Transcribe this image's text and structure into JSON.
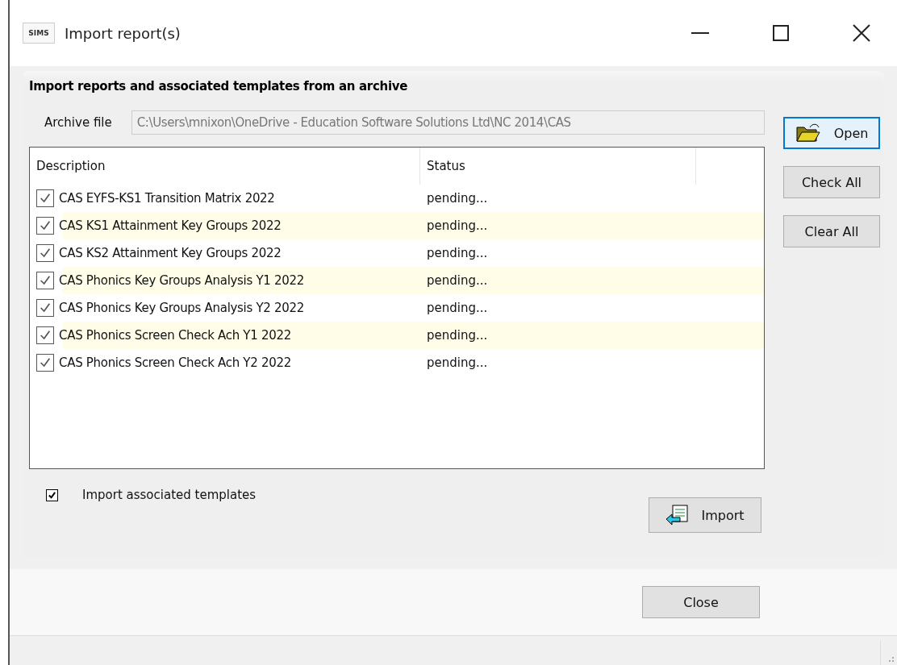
{
  "window": {
    "title": "Import report(s)",
    "app_icon_text": "SIMS"
  },
  "heading": "Import reports and associated templates from an archive",
  "archive": {
    "label": "Archive file",
    "value": "C:\\Users\\mnixon\\OneDrive - Education Software Solutions Ltd\\NC 2014\\CAS"
  },
  "buttons": {
    "open": "Open",
    "check_all": "Check All",
    "clear_all": "Clear All",
    "import": "Import",
    "close": "Close"
  },
  "table": {
    "columns": [
      "Description",
      "Status"
    ],
    "rows": [
      {
        "description": "CAS EYFS-KS1 Transition Matrix 2022",
        "status": "pending...",
        "checked": true
      },
      {
        "description": "CAS KS1 Attainment Key Groups 2022",
        "status": "pending...",
        "checked": true
      },
      {
        "description": "CAS KS2 Attainment Key Groups 2022",
        "status": "pending...",
        "checked": true
      },
      {
        "description": "CAS Phonics Key Groups Analysis Y1 2022",
        "status": "pending...",
        "checked": true
      },
      {
        "description": "CAS Phonics Key Groups Analysis Y2 2022",
        "status": "pending...",
        "checked": true
      },
      {
        "description": "CAS Phonics Screen Check Ach Y1 2022",
        "status": "pending...",
        "checked": true
      },
      {
        "description": "CAS Phonics Screen Check Ach Y2 2022",
        "status": "pending...",
        "checked": true
      }
    ]
  },
  "import_templates": {
    "label": "Import associated templates",
    "checked": true
  }
}
